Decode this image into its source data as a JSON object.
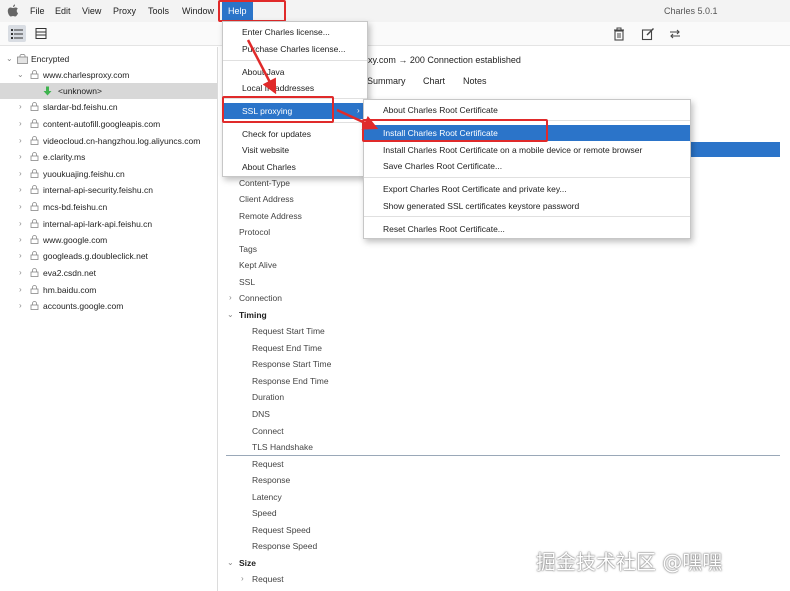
{
  "menubar": {
    "items": [
      "File",
      "Edit",
      "View",
      "Proxy",
      "Tools",
      "Window"
    ],
    "help": "Help",
    "app_title": "Charles 5.0.1"
  },
  "sidebar": {
    "root": "Encrypted",
    "items": [
      {
        "label": "www.charlesproxy.com",
        "expanded": true
      },
      {
        "label": "<unknown>",
        "selected": true
      },
      {
        "label": "slardar-bd.feishu.cn"
      },
      {
        "label": "content-autofill.googleapis.com"
      },
      {
        "label": "videocloud.cn-hangzhou.log.aliyuncs.com"
      },
      {
        "label": "e.clarity.ms"
      },
      {
        "label": "yuoukuajing.feishu.cn"
      },
      {
        "label": "internal-api-security.feishu.cn"
      },
      {
        "label": "mcs-bd.feishu.cn"
      },
      {
        "label": "internal-api-lark-api.feishu.cn"
      },
      {
        "label": "www.google.com"
      },
      {
        "label": "googleads.g.doubleclick.net"
      },
      {
        "label": "eva2.csdn.net"
      },
      {
        "label": "hm.baidu.com"
      },
      {
        "label": "accounts.google.com"
      }
    ]
  },
  "main": {
    "connection_title": "xy.com → 200 Connection established",
    "tabs": [
      "Summary",
      "Chart",
      "Notes"
    ],
    "props": [
      "Content-Type",
      "Client Address",
      "Remote Address",
      "Protocol",
      "Tags",
      "Kept Alive",
      "SSL",
      "Connection"
    ],
    "timing_header": "Timing",
    "timing_items": [
      "Request Start Time",
      "Request End Time",
      "Response Start Time",
      "Response End Time",
      "Duration",
      "DNS",
      "Connect",
      "TLS Handshake"
    ],
    "speed_items": [
      "Request",
      "Response",
      "Latency",
      "Speed",
      "Request Speed",
      "Response Speed"
    ],
    "size_header": "Size",
    "size_items": [
      "Request"
    ]
  },
  "help_menu": {
    "items": [
      "Enter Charles license...",
      "Purchase Charles license...",
      "About Java",
      "Local IP addresses",
      "SSL proxying",
      "Check for updates",
      "Visit website",
      "About Charles"
    ]
  },
  "ssl_submenu": {
    "items": [
      "About Charles Root Certificate",
      "Install Charles Root Certificate",
      "Install Charles Root Certificate on a mobile device or remote browser",
      "Save Charles Root Certificate...",
      "Export Charles Root Certificate and private key...",
      "Show generated SSL certificates keystore password",
      "Reset Charles Root Certificate..."
    ]
  },
  "watermark": "掘金技术社区 @嘿嘿",
  "colors": {
    "highlight": "#2b74c9",
    "annotation": "#e02a2a"
  }
}
